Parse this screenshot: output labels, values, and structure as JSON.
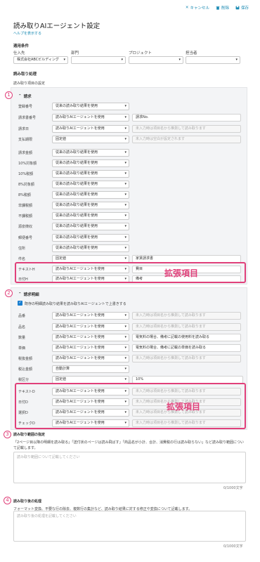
{
  "toolbar": {
    "cancel": "キャンセル",
    "delete": "削除",
    "save": "保存"
  },
  "page": {
    "title": "読み取りAIエージェント設定",
    "help": "ヘルプを表示する"
  },
  "conditions": {
    "heading": "適用条件",
    "fields": [
      {
        "label": "仕入先",
        "value": "株式会社ABCビルディング"
      },
      {
        "label": "部門",
        "value": ""
      },
      {
        "label": "プロジェクト",
        "value": ""
      },
      {
        "label": "担当者",
        "value": ""
      }
    ]
  },
  "processing": {
    "heading": "読み取り処理",
    "sub": "読み取り項目の設定"
  },
  "invoice": {
    "heading": "請求",
    "rows": [
      {
        "label": "登録番号",
        "mode": "従来の読み取り結果を使用",
        "input": "",
        "placeholder": ""
      },
      {
        "label": "請求書番号",
        "mode": "読み取りAIエージェントを使用",
        "input": "請求No.",
        "placeholder": ""
      },
      {
        "label": "請求日",
        "mode": "読み取りAIエージェントを使用",
        "input": "",
        "placeholder": "未入力時は項目名から推測して読み取ります"
      },
      {
        "label": "支払期限",
        "mode": "固定値",
        "input": "",
        "placeholder": "未入力時は空白が設定されます"
      },
      {
        "label": "請求金額",
        "mode": "従来の読み取り結果を使用",
        "input": "",
        "placeholder": ""
      },
      {
        "label": "10%対象額",
        "mode": "従来の読み取り結果を使用",
        "input": "",
        "placeholder": ""
      },
      {
        "label": "10%税額",
        "mode": "従来の読み取り結果を使用",
        "input": "",
        "placeholder": ""
      },
      {
        "label": "8%対象額",
        "mode": "従来の読み取り結果を使用",
        "input": "",
        "placeholder": ""
      },
      {
        "label": "8%税額",
        "mode": "従来の読み取り結果を使用",
        "input": "",
        "placeholder": ""
      },
      {
        "label": "非課税額",
        "mode": "従来の読み取り結果を使用",
        "input": "",
        "placeholder": ""
      },
      {
        "label": "不課税額",
        "mode": "従来の読み取り結果を使用",
        "input": "",
        "placeholder": ""
      },
      {
        "label": "源泉徴収",
        "mode": "従来の読み取り結果を使用",
        "input": "",
        "placeholder": ""
      },
      {
        "label": "郵便番号",
        "mode": "従来の読み取り結果を使用",
        "input": "",
        "placeholder": ""
      },
      {
        "label": "住所",
        "mode": "従来の読み取り結果を使用",
        "input": "",
        "placeholder": ""
      },
      {
        "label": "件名",
        "mode": "固定値",
        "input": "家賃請求書",
        "placeholder": ""
      },
      {
        "label": "テキストH",
        "mode": "読み取りAIエージェントを使用",
        "input": "費目",
        "placeholder": ""
      },
      {
        "label": "日付H",
        "mode": "読み取りAIエージェントを使用",
        "input": "備考",
        "placeholder": ""
      }
    ]
  },
  "details": {
    "heading": "請求明細",
    "checkbox": "既存の明細読み取り結果を読み取りAIエージェントで上書きする",
    "rows": [
      {
        "label": "品番",
        "mode": "読み取りAIエージェントを使用",
        "input": "",
        "placeholder": "未入力時は項目名から推測して読み取ります"
      },
      {
        "label": "品名",
        "mode": "読み取りAIエージェントを使用",
        "input": "",
        "placeholder": "未入力時は項目名から推測して読み取ります"
      },
      {
        "label": "数量",
        "mode": "読み取りAIエージェントを使用",
        "input": "電気料の場合、備考に記載の使用料を読み取る",
        "placeholder": ""
      },
      {
        "label": "単価",
        "mode": "読み取りAIエージェントを使用",
        "input": "電気料の場合、備考に記載の単価を読み取る",
        "placeholder": ""
      },
      {
        "label": "税抜金額",
        "mode": "読み取りAIエージェントを使用",
        "input": "",
        "placeholder": "未入力時は項目名から推測して読み取ります"
      },
      {
        "label": "税込金額",
        "mode": "自動計算",
        "input": "",
        "placeholder": ""
      },
      {
        "label": "税区分",
        "mode": "固定値",
        "input": "10%",
        "placeholder": ""
      },
      {
        "label": "テキストD",
        "mode": "読み取りAIエージェントを使用",
        "input": "",
        "placeholder": "未入力時は項目名から推測して読み取ります"
      },
      {
        "label": "日付D",
        "mode": "読み取りAIエージェントを使用",
        "input": "",
        "placeholder": "未入力時は項目名から推測して読み取ります"
      },
      {
        "label": "選択D",
        "mode": "読み取りAIエージェントを使用",
        "input": "",
        "placeholder": "未入力時は項目名から推測して読み取ります"
      },
      {
        "label": "チェックD",
        "mode": "読み取りAIエージェントを使用",
        "input": "",
        "placeholder": "未入力時は項目名から推測して読み取ります"
      }
    ]
  },
  "extension_label": "拡張項目",
  "numbers": [
    "1",
    "2",
    "3",
    "4"
  ],
  "range": {
    "heading": "読み取り範囲の指定",
    "desc": "「2ページ目以降の明細を読み取る」「送付状のページは読み飛ばす」「商品名が小計、合計、消費税の行は読み取らない」など読み取り範囲について記載します。",
    "placeholder": "読み取り範囲について記載してください",
    "counter": "0/1000文字"
  },
  "post": {
    "heading": "読み取り後の処理",
    "desc": "フォーマット変換、不要な行の除去、複数行の集計など、読み取り結果に対する修正や変換について記載します。",
    "placeholder": "読み取り後の処理を記載してください",
    "counter": "0/1000文字"
  },
  "colors": {
    "accent": "#1a8ab3",
    "highlight": "#e0407a",
    "panel": "#f3f4f6"
  }
}
